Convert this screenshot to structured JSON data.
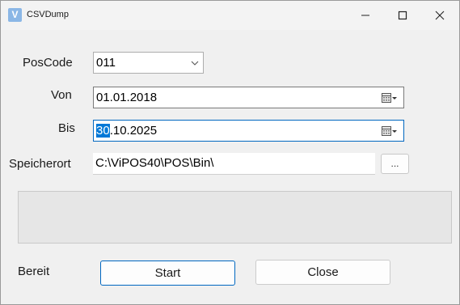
{
  "window": {
    "title": "CSVDump",
    "icon_letter": "V"
  },
  "form": {
    "poscode": {
      "label": "PosCode",
      "value": "011"
    },
    "von": {
      "label": "Von",
      "value": "01.01.2018"
    },
    "bis": {
      "label": "Bis",
      "value_selected": "30",
      "value_rest": ".10.2025"
    },
    "speicherort": {
      "label": "Speicherort",
      "value": "C:\\ViPOS40\\POS\\Bin\\",
      "browse_label": "..."
    }
  },
  "status": {
    "text": "Bereit"
  },
  "buttons": {
    "start_label": "Start",
    "close_label": "Close"
  },
  "colors": {
    "accent": "#0067c0",
    "selection": "#0078d7"
  },
  "icons": [
    "app-icon",
    "minimize-icon",
    "maximize-icon",
    "close-icon",
    "chevron-down-icon",
    "calendar-icon"
  ]
}
